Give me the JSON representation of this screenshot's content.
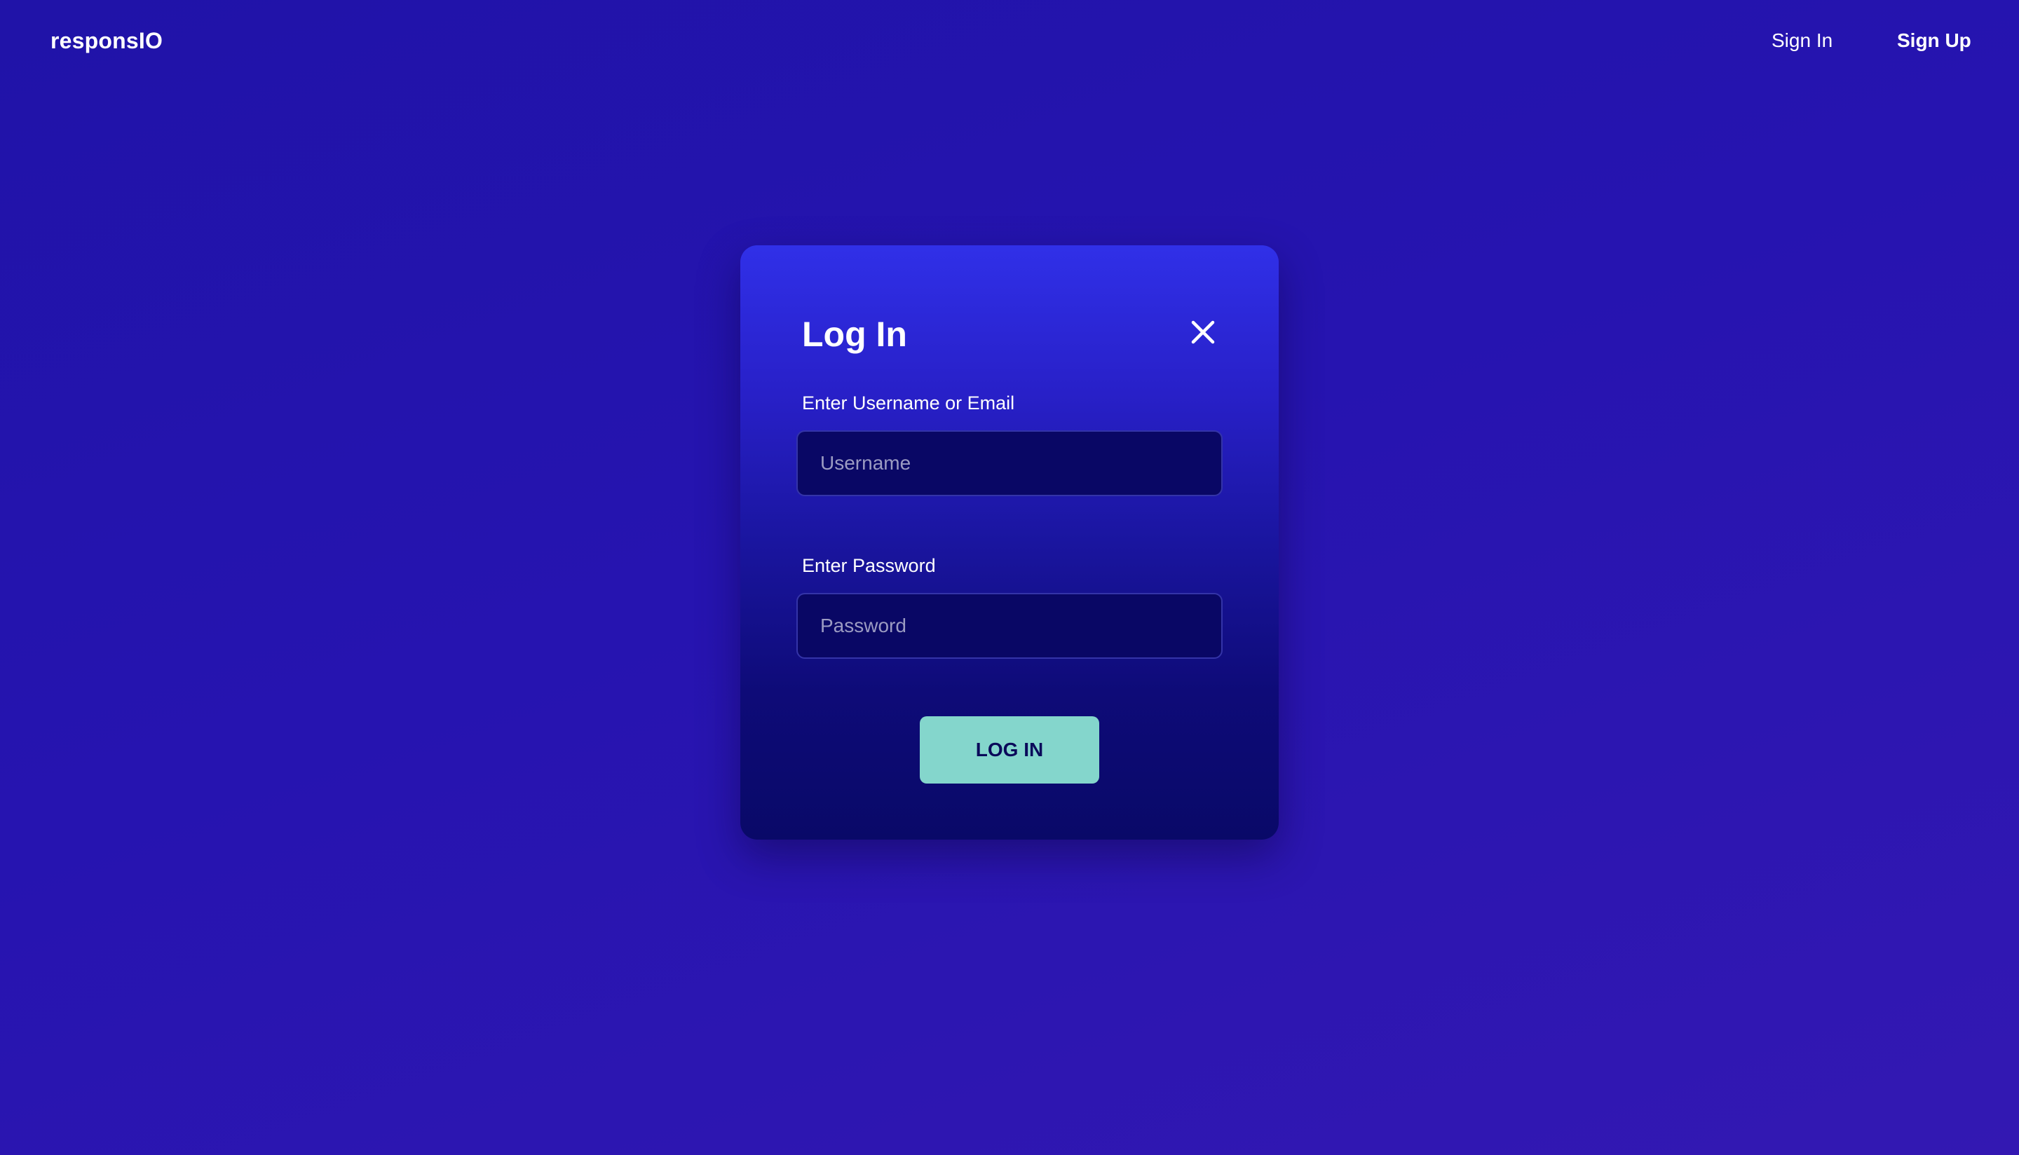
{
  "header": {
    "logo": "responsIO",
    "nav": {
      "sign_in": "Sign In",
      "sign_up": "Sign Up"
    }
  },
  "modal": {
    "title": "Log In",
    "close_icon": "close-icon",
    "username": {
      "label": "Enter Username or Email",
      "placeholder": "Username",
      "value": ""
    },
    "password": {
      "label": "Enter Password",
      "placeholder": "Password",
      "value": ""
    },
    "submit_label": "LOG IN"
  },
  "colors": {
    "background": "#2314ad",
    "modal_top": "#3030e8",
    "modal_bottom": "#090968",
    "input_bg": "#090765",
    "button_bg": "#84d6cc",
    "button_text": "#0a0a5a"
  }
}
